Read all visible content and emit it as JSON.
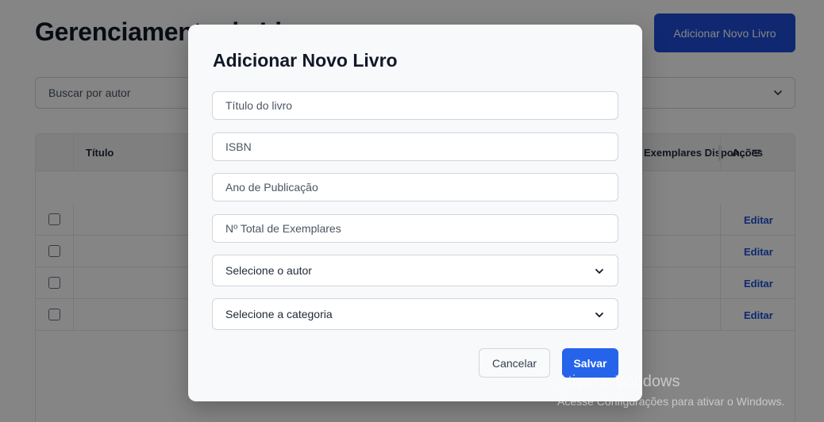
{
  "page": {
    "title": "Gerenciamento de Livros",
    "add_button_label": "Adicionar Novo Livro",
    "search_placeholder": "Buscar por autor"
  },
  "table": {
    "columns": {
      "title": "Título",
      "available": "Exemplares Dispon...",
      "actions": "Ações"
    },
    "rows": [
      {
        "action_label": "Editar"
      },
      {
        "action_label": "Editar"
      },
      {
        "action_label": "Editar"
      },
      {
        "action_label": "Editar"
      }
    ]
  },
  "modal": {
    "title": "Adicionar Novo Livro",
    "fields": {
      "title_placeholder": "Título do livro",
      "isbn_placeholder": "ISBN",
      "year_placeholder": "Ano de Publicação",
      "copies_placeholder": "Nº Total de Exemplares"
    },
    "selects": {
      "author_value": "Selecione o autor",
      "category_value": "Selecione a categoria"
    },
    "buttons": {
      "cancel_label": "Cancelar",
      "save_label": "Salvar"
    }
  },
  "watermark": {
    "title": "Ativar o Windows",
    "subtitle": "Acesse Configurações para ativar o Windows."
  },
  "colors": {
    "primary": "#2563eb",
    "primary_dark": "#1d4ed8",
    "overlay": "rgba(0,0,0,0.48)"
  },
  "icons": {
    "select_chevron": "chevron-down-icon",
    "filter": "filter-icon"
  }
}
